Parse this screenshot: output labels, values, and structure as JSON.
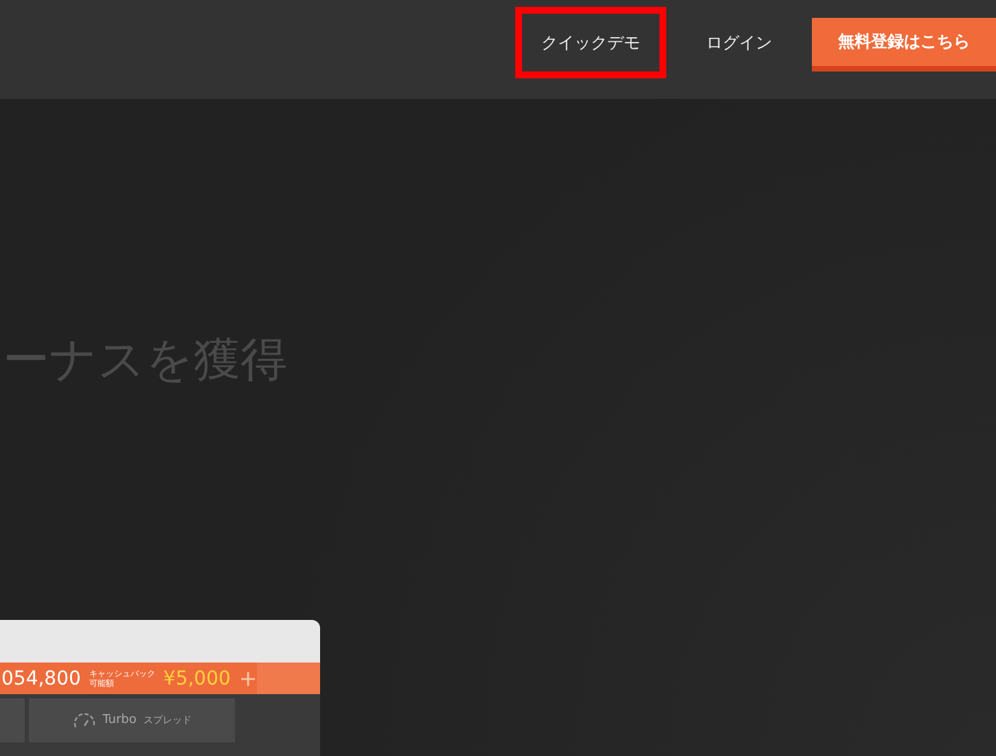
{
  "header": {
    "nav": [
      {
        "label": "クイックデモ",
        "highlighted": true
      },
      {
        "label": "ログイン",
        "highlighted": false
      }
    ],
    "signup_button": "無料登録はこちら"
  },
  "hero": {
    "headline": "ーナスを獲得"
  },
  "app_preview": {
    "balance": "054,800",
    "cashback_label": "キャッシュバック",
    "cashback_sub": "可能額",
    "cashback_amount": "¥5,000",
    "add": "+",
    "tiles": [
      {
        "kind": "blank"
      },
      {
        "kind": "gauge",
        "brand": "Turbo",
        "label": "スプレッド"
      }
    ]
  }
}
